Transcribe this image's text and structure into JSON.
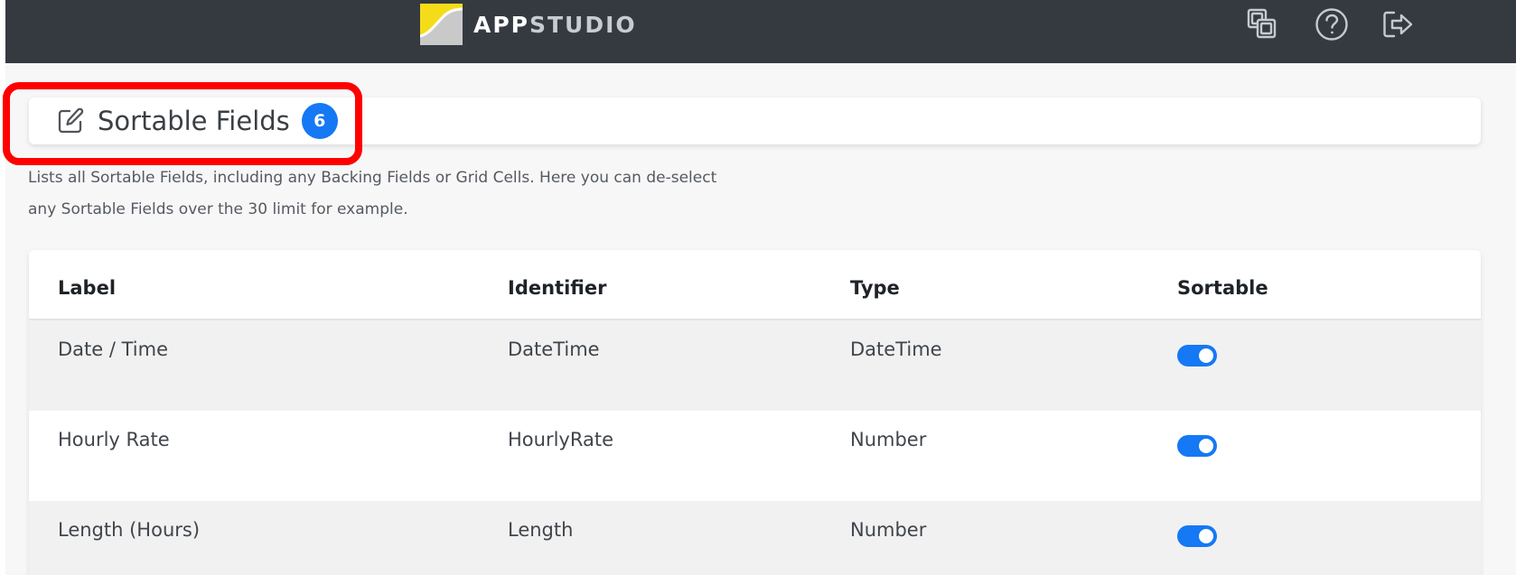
{
  "brand": {
    "name_part1": "APP",
    "name_part2": "STUDIO"
  },
  "topbar_icons": [
    "copy-icon",
    "help-icon",
    "logout-icon"
  ],
  "page": {
    "title": "Sortable Fields",
    "count": "6",
    "description_line1": "Lists all Sortable Fields, including any Backing Fields or Grid Cells. Here you can de-select",
    "description_line2": "any Sortable Fields over the 30 limit for example."
  },
  "table": {
    "columns": [
      "Label",
      "Identifier",
      "Type",
      "Sortable"
    ],
    "rows": [
      {
        "label": "Date / Time",
        "identifier": "DateTime",
        "type": "DateTime",
        "sortable": true
      },
      {
        "label": "Hourly Rate",
        "identifier": "HourlyRate",
        "type": "Number",
        "sortable": true
      },
      {
        "label": "Length (Hours)",
        "identifier": "Length",
        "type": "Number",
        "sortable": true
      }
    ]
  },
  "colors": {
    "topbar": "#353a41",
    "accent": "#1578f4",
    "highlight": "#ff0000",
    "logo_yellow": "#f5dc18"
  }
}
